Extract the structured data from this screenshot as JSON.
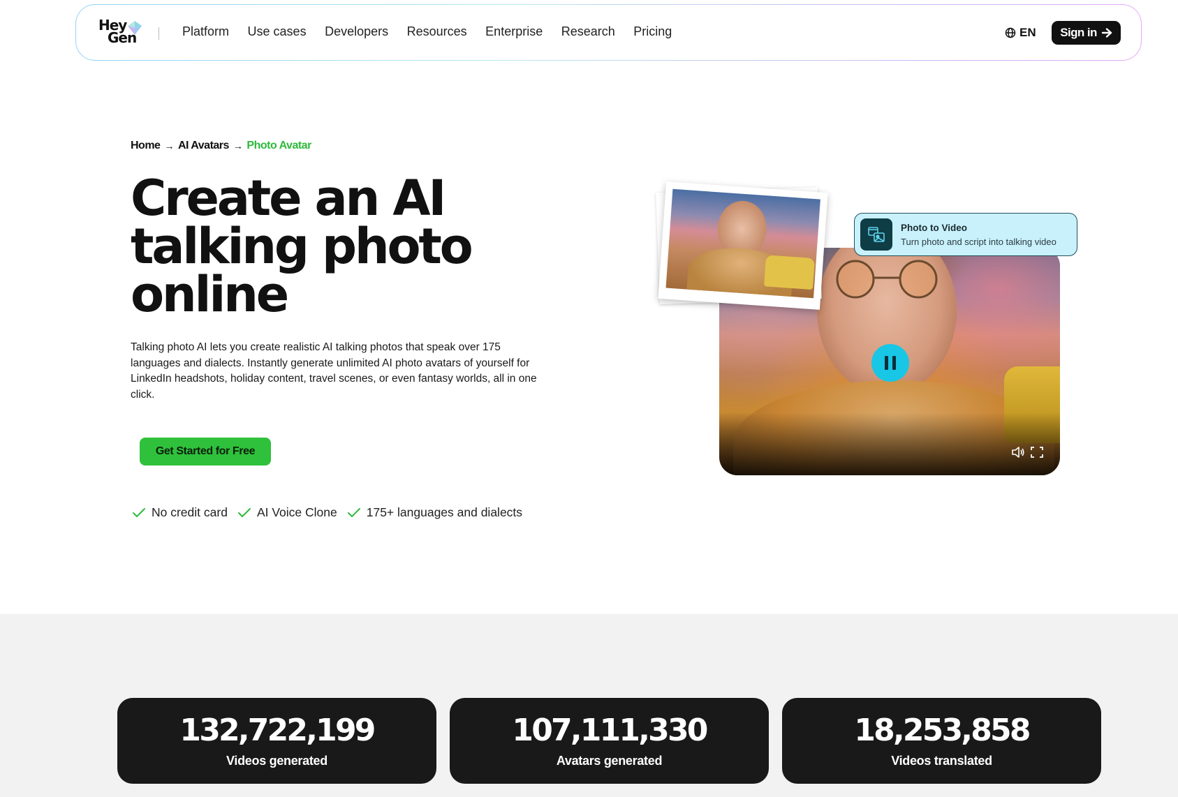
{
  "nav": {
    "logo_line1": "Hey",
    "logo_line2": "Gen",
    "links": [
      "Platform",
      "Use cases",
      "Developers",
      "Resources",
      "Enterprise",
      "Research",
      "Pricing"
    ],
    "language": "EN",
    "signin_label": "Sign in"
  },
  "breadcrumb": {
    "items": [
      "Home",
      "AI Avatars",
      "Photo Avatar"
    ]
  },
  "hero": {
    "title_line1": "Create an AI",
    "title_line2": "talking photo",
    "title_line3": "online",
    "description": "Talking photo AI lets you create realistic AI talking photos that speak over 175 languages and dialects. Instantly generate unlimited AI photo avatars of yourself for LinkedIn headshots, holiday content, travel scenes, or even fantasy worlds, all in one click.",
    "cta_label": "Get Started for Free",
    "features": [
      "No credit card",
      "AI Voice Clone",
      "175+ languages and dialects"
    ]
  },
  "media": {
    "tooltip_title": "Photo to Video",
    "tooltip_subtitle": "Turn photo and script into talking video"
  },
  "stats": [
    {
      "value": "132,722,199",
      "label": "Videos generated"
    },
    {
      "value": "107,111,330",
      "label": "Avatars generated"
    },
    {
      "value": "18,253,858",
      "label": "Videos translated"
    }
  ],
  "colors": {
    "accent_green": "#2fc13c",
    "breadcrumb_active": "#2fb93b",
    "play_button": "#18c6e6",
    "dark": "#191919"
  }
}
